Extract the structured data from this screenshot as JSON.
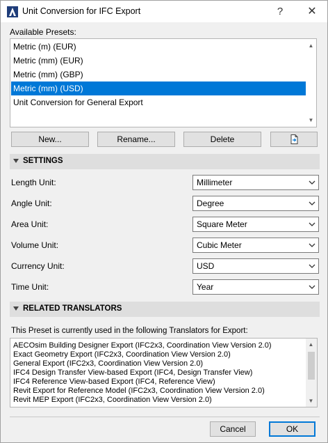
{
  "window": {
    "title": "Unit Conversion for IFC Export",
    "help_label": "?",
    "close_label": "✕"
  },
  "presets": {
    "label": "Available Presets:",
    "items": [
      "Metric (m) (EUR)",
      "Metric (mm) (EUR)",
      "Metric (mm) (GBP)",
      "Metric (mm) (USD)",
      "Unit Conversion for General Export"
    ],
    "selected_index": 3,
    "buttons": {
      "new_label": "New...",
      "rename_label": "Rename...",
      "delete_label": "Delete"
    }
  },
  "settings": {
    "header": "SETTINGS",
    "fields": [
      {
        "label": "Length Unit:",
        "value": "Millimeter"
      },
      {
        "label": "Angle Unit:",
        "value": "Degree"
      },
      {
        "label": "Area Unit:",
        "value": "Square Meter"
      },
      {
        "label": "Volume Unit:",
        "value": "Cubic Meter"
      },
      {
        "label": "Currency Unit:",
        "value": "USD"
      },
      {
        "label": "Time Unit:",
        "value": "Year"
      }
    ]
  },
  "translators": {
    "header": "RELATED TRANSLATORS",
    "intro": "This Preset is currently used in the following Translators for Export:",
    "items": [
      "AECOsim Building Designer Export (IFC2x3, Coordination View Version 2.0)",
      "Exact Geometry Export (IFC2x3, Coordination View Version 2.0)",
      "General Export (IFC2x3, Coordination View Version 2.0)",
      "IFC4 Design Transfer View-based Export (IFC4, Design Transfer View)",
      "IFC4 Reference View-based Export (IFC4, Reference View)",
      "Revit Export for Reference Model (IFC2x3, Coordination View Version 2.0)",
      "Revit MEP Export (IFC2x3, Coordination View Version 2.0)"
    ]
  },
  "footer": {
    "cancel_label": "Cancel",
    "ok_label": "OK"
  },
  "colors": {
    "selection": "#0078d7",
    "section_header": "#dedede"
  }
}
